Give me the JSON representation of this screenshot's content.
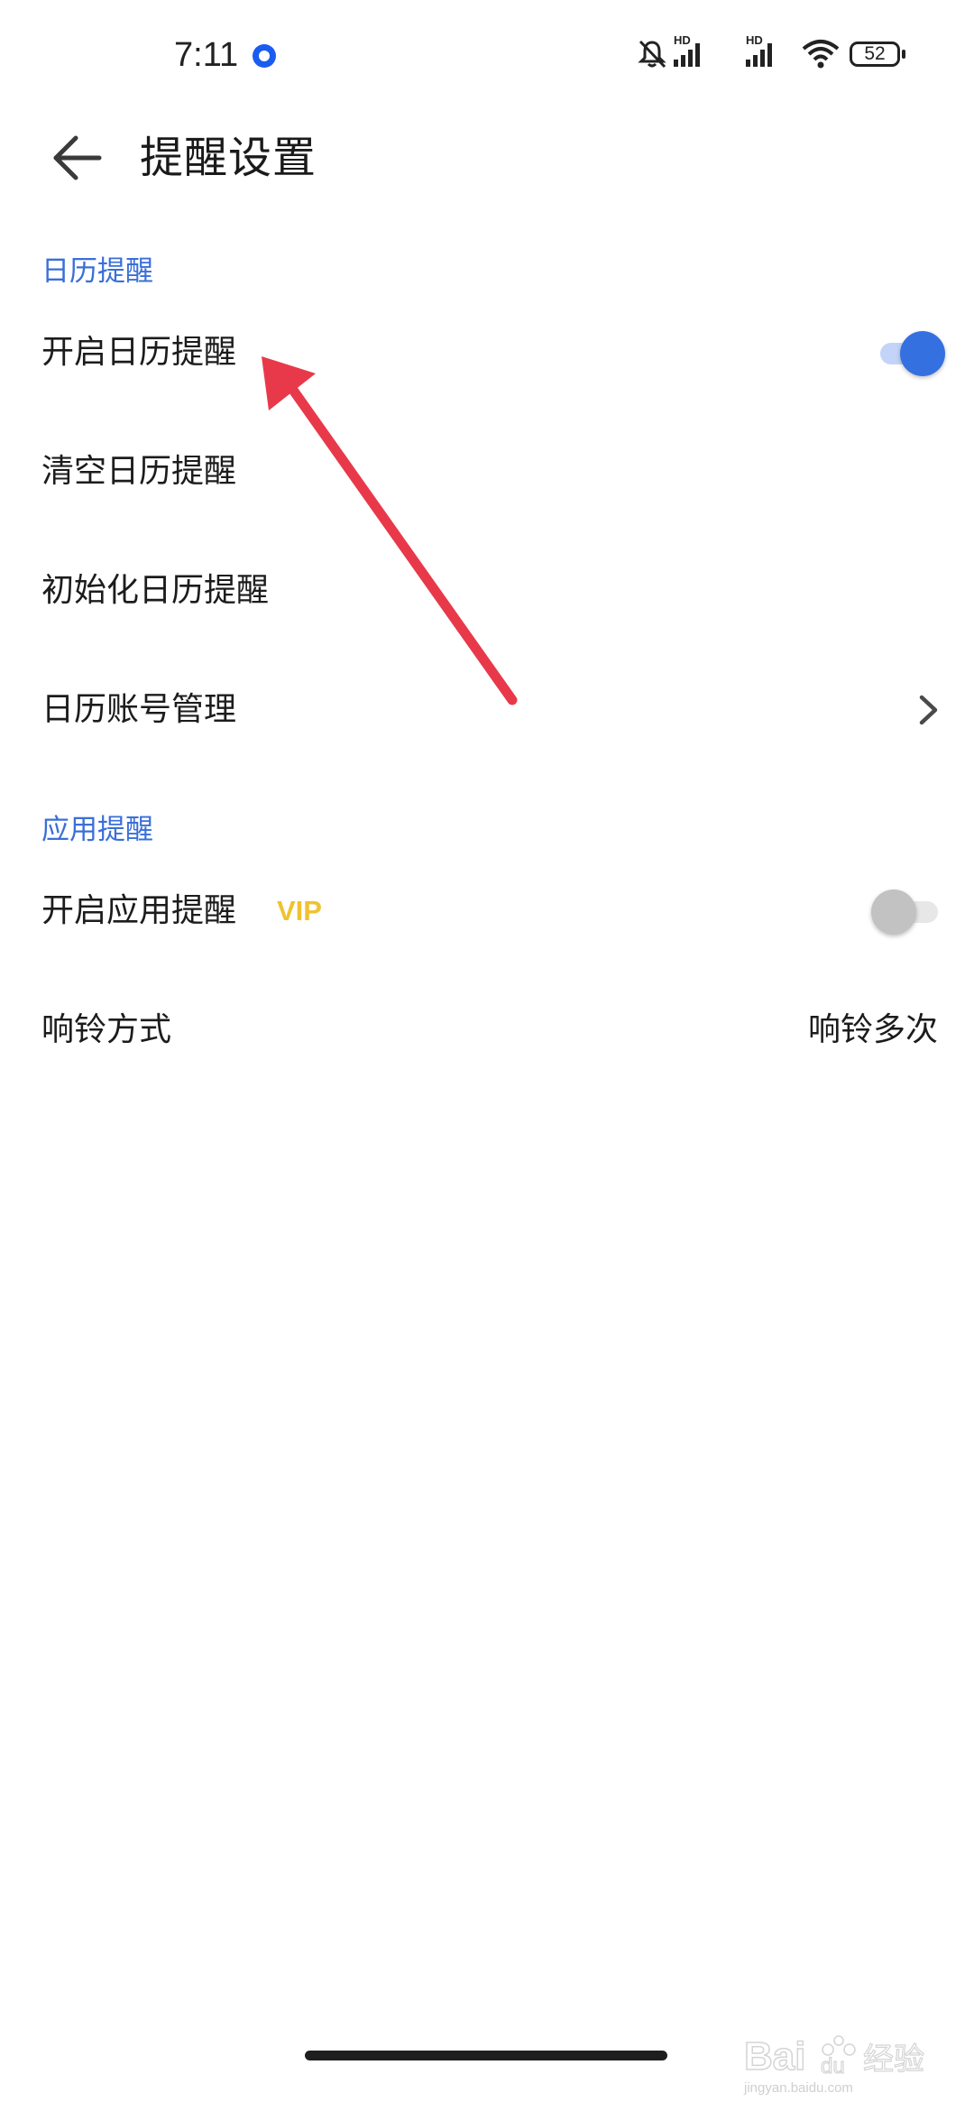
{
  "status_bar": {
    "time": "7:11",
    "battery": "52",
    "hd_label_1": "HD",
    "hd_label_2": "HD",
    "icons": [
      "app-notification-icon",
      "mute-icon",
      "signal-icon",
      "signal-icon",
      "wifi-icon",
      "battery-icon"
    ]
  },
  "app_bar": {
    "title": "提醒设置",
    "back_icon": "back-arrow-icon"
  },
  "sections": {
    "calendar": {
      "header": "日历提醒",
      "rows": {
        "enable": {
          "label": "开启日历提醒",
          "toggle_on": true
        },
        "clear": {
          "label": "清空日历提醒"
        },
        "init": {
          "label": "初始化日历提醒"
        },
        "accounts": {
          "label": "日历账号管理",
          "icon": "chevron-right-icon"
        }
      }
    },
    "app": {
      "header": "应用提醒",
      "rows": {
        "enable": {
          "label": "开启应用提醒",
          "badge": "VIP",
          "toggle_on": false
        },
        "ring_mode": {
          "label": "响铃方式",
          "value": "响铃多次"
        }
      }
    }
  },
  "watermark": {
    "text": "jingyan.baidu.com"
  },
  "colors": {
    "accent": "#3570e0",
    "section_header": "#3a6fd8",
    "vip": "#f0c230",
    "annotation": "#e8394a"
  }
}
